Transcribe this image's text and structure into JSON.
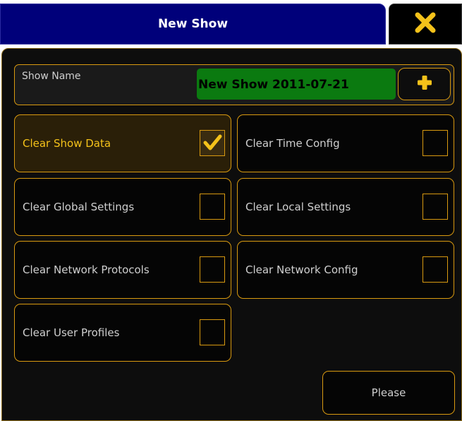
{
  "window": {
    "title": "New Show",
    "close_icon": "close-x-icon"
  },
  "show_name": {
    "label": "Show Name",
    "value": "New Show 2011-07-21",
    "add_icon": "plus-icon"
  },
  "options": [
    {
      "label": "Clear Show Data",
      "checked": true
    },
    {
      "label": "Clear Time Config",
      "checked": false
    },
    {
      "label": "Clear Global Settings",
      "checked": false
    },
    {
      "label": "Clear Local Settings",
      "checked": false
    },
    {
      "label": "Clear Network Protocols",
      "checked": false
    },
    {
      "label": "Clear Network Config",
      "checked": false
    },
    {
      "label": "Clear User Profiles",
      "checked": false
    }
  ],
  "actions": {
    "please_label": "Please"
  },
  "colors": {
    "title_bg": "#00007a",
    "accent": "#f4c21a",
    "border": "#d99a10",
    "show_name_bg": "#0b7a10"
  }
}
